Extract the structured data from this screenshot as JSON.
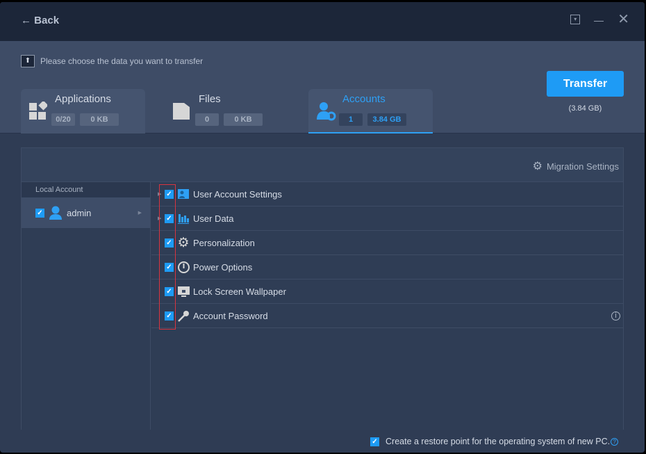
{
  "titlebar": {
    "back_label": "Back"
  },
  "header": {
    "prompt": "Please choose the data you want to transfer",
    "tabs": [
      {
        "title": "Applications",
        "count": "0/20",
        "size": "0 KB"
      },
      {
        "title": "Files",
        "count": "0",
        "size": "0 KB"
      },
      {
        "title": "Accounts",
        "count": "1",
        "size": "3.84 GB"
      }
    ],
    "transfer_label": "Transfer",
    "transfer_size": "(3.84 GB)"
  },
  "panel": {
    "migration_settings": "Migration Settings",
    "left_header": "Local Account",
    "account": "admin",
    "items": [
      {
        "label": "User Account Settings",
        "checked": true,
        "expandable": true
      },
      {
        "label": "User Data",
        "checked": true,
        "expandable": true
      },
      {
        "label": "Personalization",
        "checked": true
      },
      {
        "label": "Power Options",
        "checked": true
      },
      {
        "label": "Lock Screen Wallpaper",
        "checked": true
      },
      {
        "label": "Account Password",
        "checked": true
      }
    ]
  },
  "footer": {
    "restore_label": "Create a restore point for the operating system of new PC.",
    "restore_checked": true
  },
  "colors": {
    "accent": "#1e9bf5",
    "highlight": "#d9343f"
  }
}
